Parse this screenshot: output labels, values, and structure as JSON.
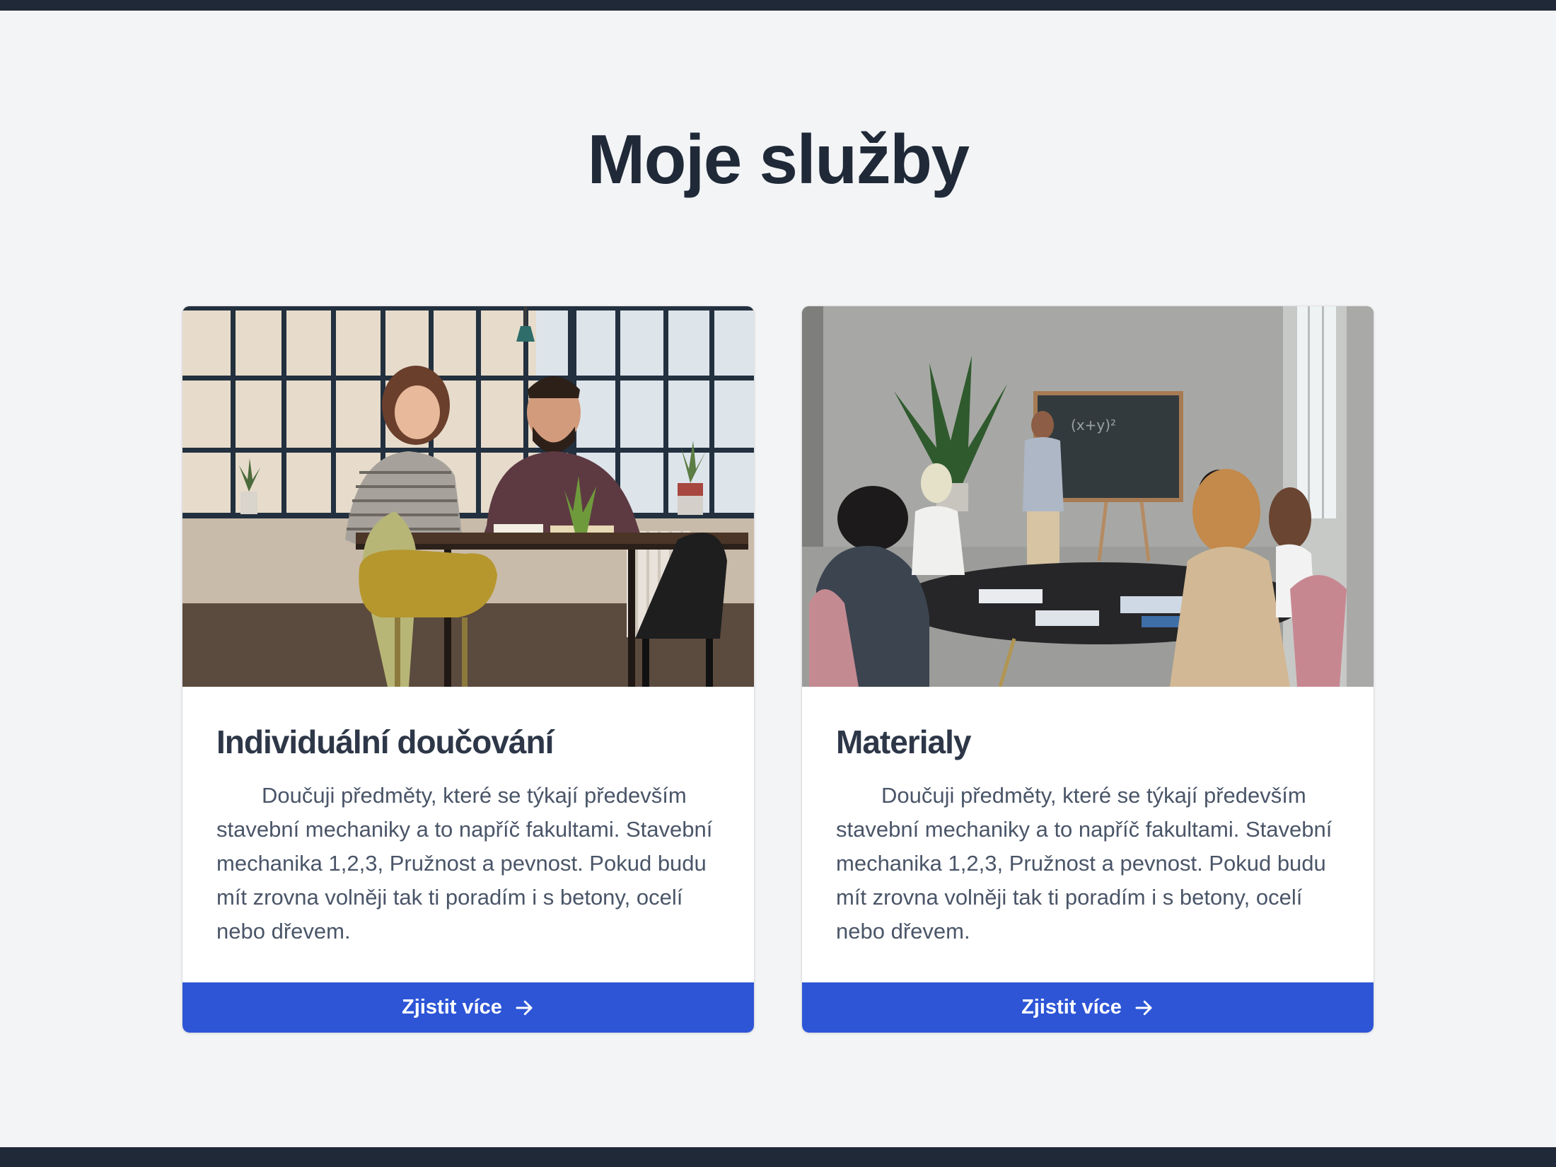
{
  "page": {
    "title": "Moje služby"
  },
  "cards": [
    {
      "image_icon": "tutoring-photo",
      "title": "Individuální doučování",
      "text": "Doučuji předměty, které se týkají především stavební mechaniky a to napříč fakultami. Stavební mechanika 1,2,3, Pružnost a pevnost. Pokud budu mít zrovna volněji tak ti poradím i s betony, ocelí nebo dřevem.",
      "button_label": "Zjistit více"
    },
    {
      "image_icon": "classroom-photo",
      "title": "Materialy",
      "text": "Doučuji předměty, které se týkají především stavební mechaniky a to napříč fakultami. Stavební mechanika 1,2,3, Pružnost a pevnost. Pokud budu mít zrovna volněji tak ti poradím i s betony, ocelí nebo dřevem.",
      "button_label": "Zjistit více"
    }
  ],
  "colors": {
    "background": "#f3f4f6",
    "dark_bar": "#1f2937",
    "heading": "#1f2937",
    "card_title": "#2d3748",
    "body_text": "#4a5568",
    "button": "#2d55d6",
    "button_text": "#ffffff"
  }
}
